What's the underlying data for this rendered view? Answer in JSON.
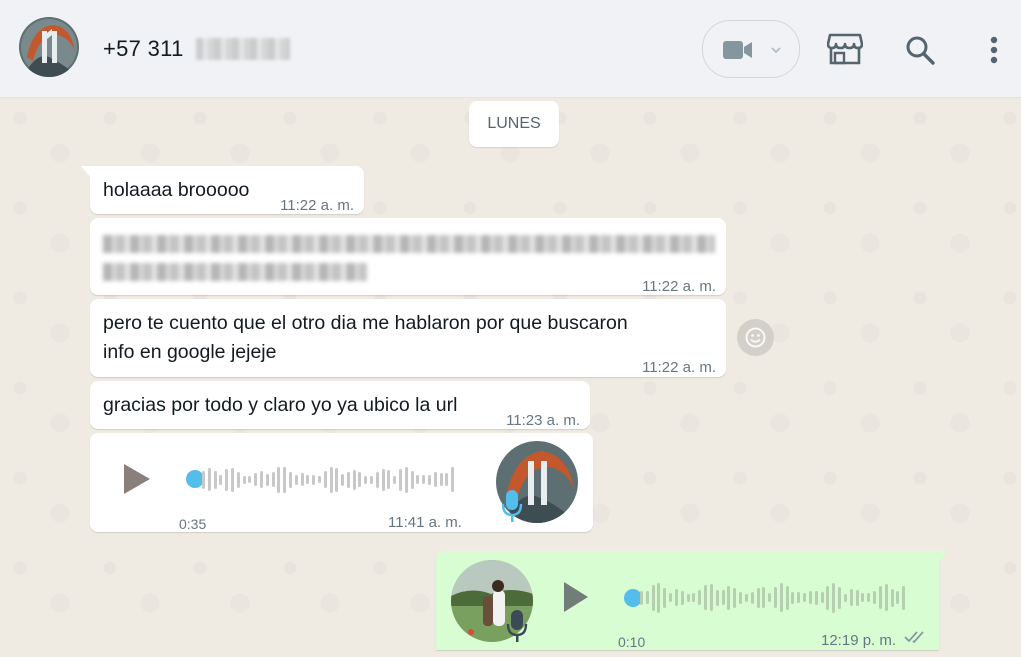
{
  "header": {
    "contact_name": "+57 311",
    "icons": [
      "avatar",
      "video-call-icon",
      "chevron-down-icon",
      "catalog-store-icon",
      "search-icon",
      "menu-icon"
    ]
  },
  "chat": {
    "day_separator": "LUNES",
    "messages": [
      {
        "type": "text",
        "direction": "in",
        "text": "holaaaa brooooo",
        "time": "11:22 a. m."
      },
      {
        "type": "text",
        "direction": "in",
        "text": "",
        "time": "11:22 a. m."
      },
      {
        "type": "text",
        "direction": "in",
        "text_line1": "pero te cuento que el otro dia me hablaron por que buscaron",
        "text_line2": "info en google jejeje",
        "time": "11:22 a. m."
      },
      {
        "type": "text",
        "direction": "in",
        "text": "gracias por todo y claro yo ya ubico la url",
        "time": "11:23 a. m."
      },
      {
        "type": "voice",
        "direction": "in",
        "duration": "0:35",
        "time": "11:41 a. m.",
        "progress": 0
      },
      {
        "type": "voice",
        "direction": "out",
        "duration": "0:10",
        "time": "12:19 p. m.",
        "progress": 0,
        "status": "delivered"
      }
    ]
  },
  "colors": {
    "header_bg": "#f0f2f5",
    "chat_bg": "#efeae2",
    "incoming_bubble": "#ffffff",
    "outgoing_bubble": "#d9fdd3",
    "play_progress": "#53bdeb",
    "mic_icon": "#53bdeb"
  }
}
